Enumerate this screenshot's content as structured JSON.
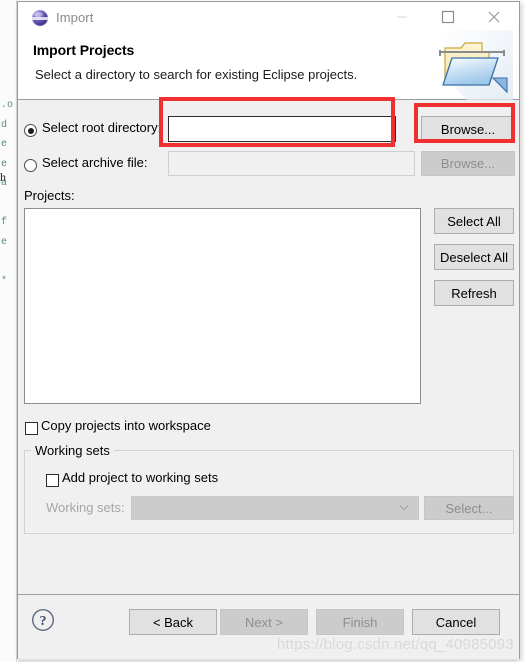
{
  "window": {
    "title": "Import",
    "app_icon": "eclipse-sphere-icon",
    "controls": {
      "minimize": "minimize-icon",
      "maximize": "maximize-icon",
      "close": "close-icon"
    }
  },
  "header": {
    "title": "Import Projects",
    "description": "Select a directory to search for existing Eclipse projects.",
    "icon": "open-folder-icon"
  },
  "source": {
    "root_directory": {
      "label": "Select root directory:",
      "selected": true,
      "value": "",
      "placeholder": "",
      "browse_label": "Browse..."
    },
    "archive_file": {
      "label": "Select archive file:",
      "selected": false,
      "value": "",
      "placeholder": "",
      "browse_label": "Browse...",
      "disabled": true
    }
  },
  "projects": {
    "label": "Projects:",
    "items": [],
    "buttons": {
      "select_all": "Select All",
      "deselect_all": "Deselect All",
      "refresh": "Refresh"
    }
  },
  "options": {
    "copy_projects": {
      "label": "Copy projects into workspace",
      "checked": false
    }
  },
  "working_sets": {
    "group_title": "Working sets",
    "add_to_working_sets": {
      "label": "Add project to working sets",
      "checked": false
    },
    "combo_label": "Working sets:",
    "combo_value": "",
    "select_label": "Select...",
    "disabled": true
  },
  "footer": {
    "help": "help-icon",
    "back": "< Back",
    "next": "Next >",
    "finish": "Finish",
    "cancel": "Cancel",
    "next_disabled": true,
    "finish_disabled": true
  },
  "watermark": "https://blog.csdn.net/qq_40985093",
  "background": {
    "code_gutter": ".o\nd\ne\ne\na\n\nf\ne\n\n*",
    "edge_char": "h"
  },
  "colors": {
    "annotation": "#f03030",
    "dialog_bg": "#f0f0f0",
    "button_bg": "#e1e1e1",
    "disabled_bg": "#cccccc",
    "title_text": "#8a8a8a"
  }
}
